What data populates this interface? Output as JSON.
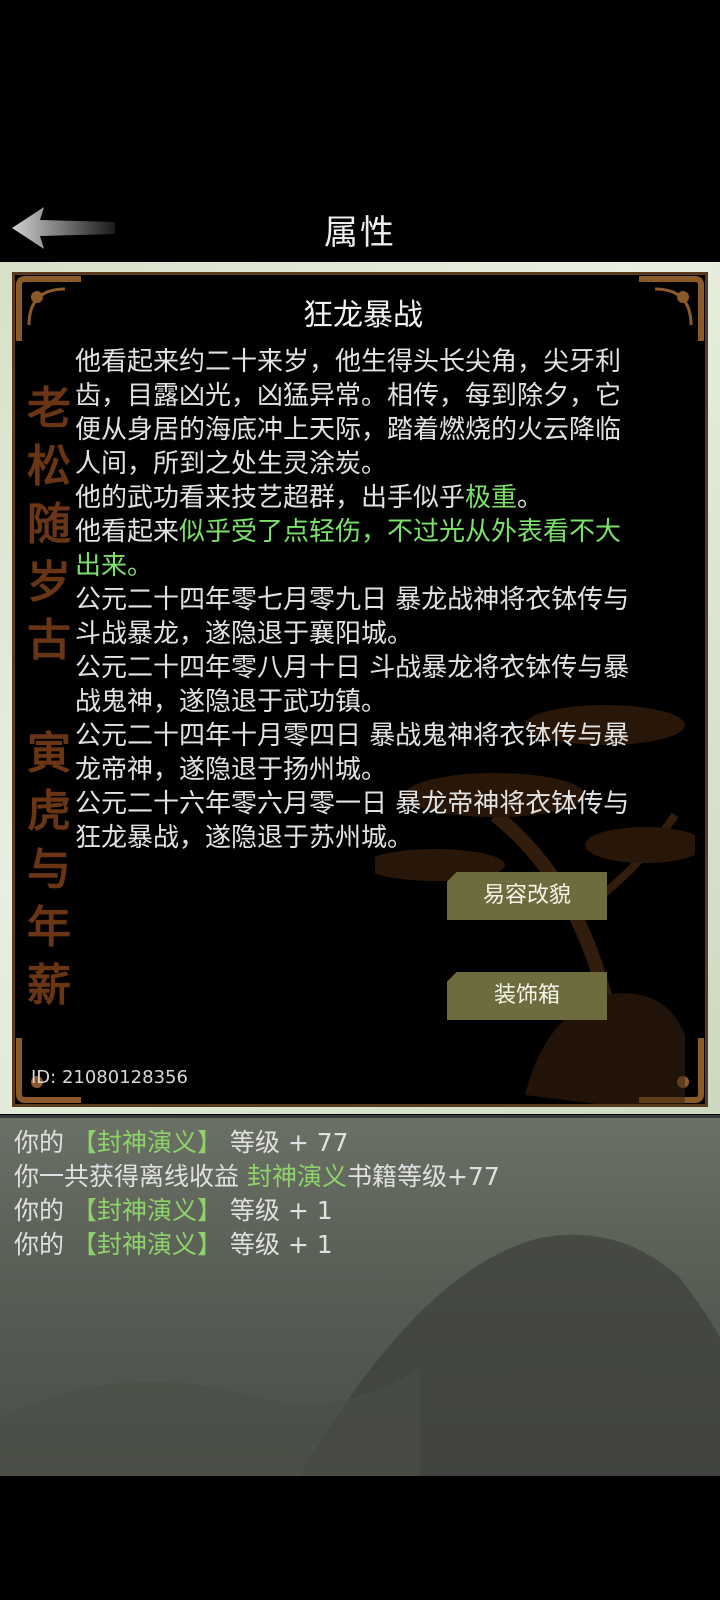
{
  "header": {
    "title": "属性"
  },
  "panel": {
    "character_name": "狂龙暴战",
    "calligraphy_left": "老松随岁古",
    "calligraphy_right": "寅虎与年薪",
    "description": [
      {
        "segments": [
          {
            "text": "他看起来约二十来岁，他生得头长尖角，尖牙利齿，目露凶光，凶猛异常。相传，每到除夕，它便从身居的海底冲上天际，踏着燃烧的火云降临人间，所到之处生灵涂炭。",
            "highlight": false
          }
        ]
      },
      {
        "segments": [
          {
            "text": "他的武功看来技艺超群，出手似乎",
            "highlight": false
          },
          {
            "text": "极重",
            "highlight": true
          },
          {
            "text": "。",
            "highlight": false
          }
        ]
      },
      {
        "segments": [
          {
            "text": "他看起来",
            "highlight": false
          },
          {
            "text": "似乎受了点轻伤，不过光从外表看不大出来。",
            "highlight": true
          }
        ]
      },
      {
        "segments": [
          {
            "text": "公元二十四年零七月零九日 暴龙战神将衣钵传与斗战暴龙，遂隐退于襄阳城。",
            "highlight": false
          }
        ]
      },
      {
        "segments": [
          {
            "text": "公元二十四年零八月十日 斗战暴龙将衣钵传与暴战鬼神，遂隐退于武功镇。",
            "highlight": false
          }
        ]
      },
      {
        "segments": [
          {
            "text": "公元二十四年十月零四日 暴战鬼神将衣钵传与暴龙帝神，遂隐退于扬州城。",
            "highlight": false
          }
        ]
      },
      {
        "segments": [
          {
            "text": "公元二十六年零六月零一日 暴龙帝神将衣钵传与狂龙暴战，遂隐退于苏州城。",
            "highlight": false
          }
        ]
      }
    ],
    "buttons": {
      "disguise": "易容改貌",
      "decor_box": "装饰箱"
    },
    "id_text": "ID:  21080128356"
  },
  "log": [
    [
      {
        "text": "你的 ",
        "green": false
      },
      {
        "text": "【封神演义】",
        "green": true
      },
      {
        "text": " 等级 + 77",
        "green": false
      }
    ],
    [
      {
        "text": "你一共获得离线收益 ",
        "green": false
      },
      {
        "text": "封神演义",
        "green": true
      },
      {
        "text": "书籍等级+77",
        "green": false
      }
    ],
    [
      {
        "text": "你的 ",
        "green": false
      },
      {
        "text": "【封神演义】",
        "green": true
      },
      {
        "text": " 等级 + 1",
        "green": false
      }
    ],
    [
      {
        "text": "你的 ",
        "green": false
      },
      {
        "text": "【封神演义】",
        "green": true
      },
      {
        "text": " 等级 + 1",
        "green": false
      }
    ]
  ],
  "colors": {
    "highlight": "#7de06c",
    "button_bg": "#6e6c3e",
    "frame": "#6a3515"
  },
  "icons": {
    "back": "back-arrow-icon"
  }
}
